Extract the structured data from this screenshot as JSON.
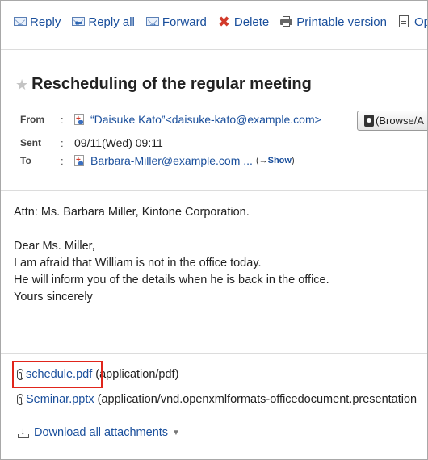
{
  "toolbar": {
    "reply": "Reply",
    "reply_all": "Reply all",
    "forward": "Forward",
    "delete": "Delete",
    "printable": "Printable version",
    "options": "Opt"
  },
  "subject": "Rescheduling of the regular meeting",
  "header": {
    "from_label": "From",
    "from_value": "“Daisuke Kato”<daisuke-kato@example.com>",
    "browse_button": "(Browse/A",
    "sent_label": "Sent",
    "sent_value": "09/11(Wed) 09:11",
    "to_label": "To",
    "to_value": "Barbara-Miller@example.com ...",
    "show_prefix": "(→",
    "show_link": "Show",
    "show_suffix": ")",
    "colon": ":"
  },
  "body": {
    "lines": [
      "Attn: Ms. Barbara Miller, Kintone Corporation.",
      "Dear Ms. Miller,",
      "I am afraid that William is not in the office today.",
      "He will inform you of the details when he is back in the office.",
      "Yours sincerely"
    ]
  },
  "attachments": [
    {
      "name": "schedule.pdf",
      "type": "(application/pdf)"
    },
    {
      "name": "Seminar.pptx",
      "type": "(application/vnd.openxmlformats-officedocument.presentation"
    }
  ],
  "download_all": "Download all attachments",
  "colors": {
    "link": "#1a4f9c",
    "highlight": "#e0251b",
    "delete_icon": "#d23a2a"
  }
}
